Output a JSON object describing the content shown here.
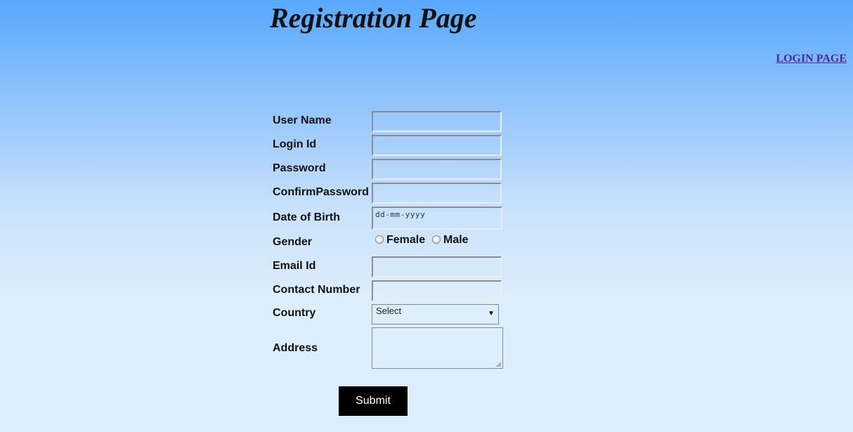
{
  "header": {
    "title": "Registration Page",
    "login_link": "LOGIN PAGE"
  },
  "form": {
    "labels": {
      "user_name": "User Name",
      "login_id": "Login Id",
      "password": "Password",
      "confirm_password": "ConfirmPassword",
      "date_of_birth": "Date of Birth",
      "gender": "Gender",
      "email": "Email Id",
      "contact": "Contact Number",
      "country": "Country",
      "address": "Address"
    },
    "values": {
      "user_name": "",
      "login_id": "",
      "password": "",
      "confirm_password": "",
      "email": "",
      "contact": "",
      "address": ""
    },
    "date_placeholder": "dd-mm-yyyy",
    "gender_options": [
      "Female",
      "Male"
    ],
    "country_selected": "Select",
    "submit_label": "Submit"
  },
  "colors": {
    "link": "#4b2c8c",
    "button_bg": "#000000",
    "button_text": "#ffffff"
  }
}
